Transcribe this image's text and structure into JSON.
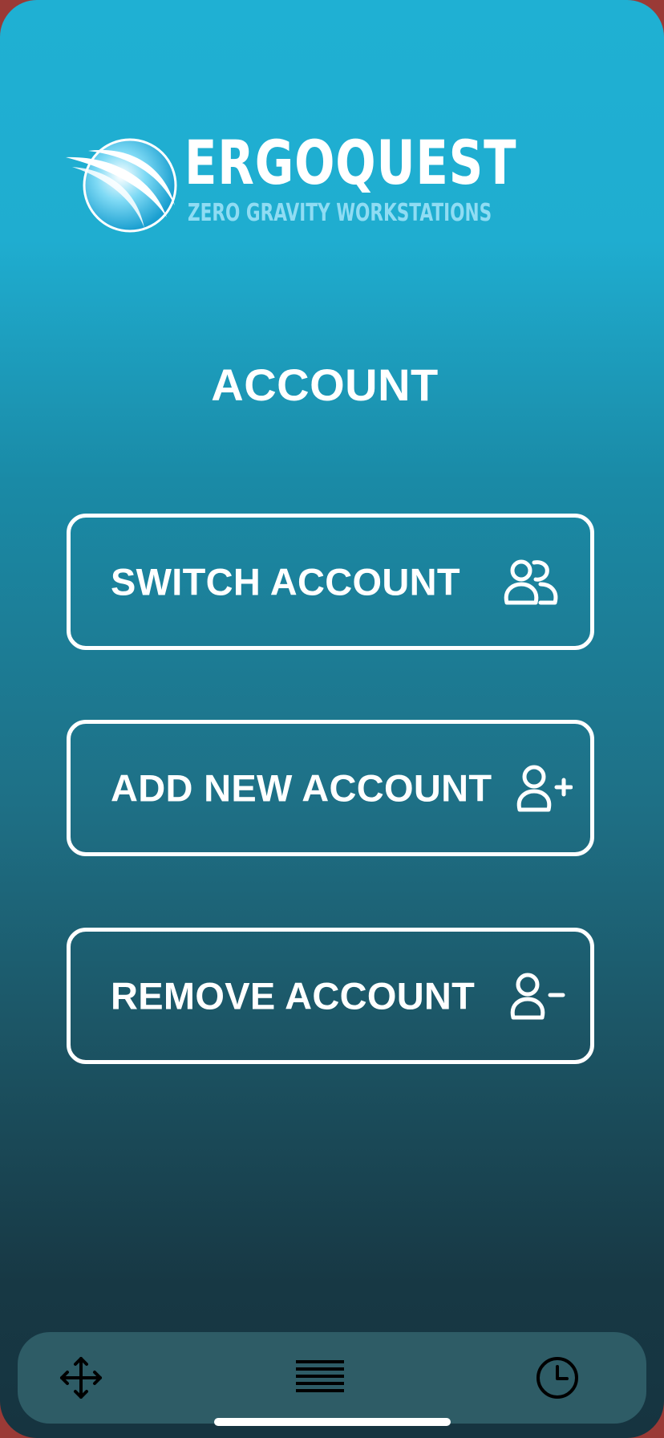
{
  "brand": {
    "name": "ERGOQUEST",
    "tagline": "ZERO GRAVITY WORKSTATIONS"
  },
  "page": {
    "title": "ACCOUNT"
  },
  "actions": [
    {
      "label": "SWITCH ACCOUNT",
      "icon": "users-icon"
    },
    {
      "label": "ADD NEW ACCOUNT",
      "icon": "user-plus-icon"
    },
    {
      "label": "REMOVE ACCOUNT",
      "icon": "user-minus-icon"
    }
  ],
  "bottom_nav": [
    {
      "icon": "move-arrows-icon"
    },
    {
      "icon": "menu-lines-icon"
    },
    {
      "icon": "clock-icon"
    }
  ],
  "colors": {
    "gradient_top": "#1fb0d3",
    "gradient_bottom": "#163440",
    "bottom_bar": "#2e5c66",
    "tagline": "#8fdcf3",
    "frame": "#9a3a36"
  }
}
